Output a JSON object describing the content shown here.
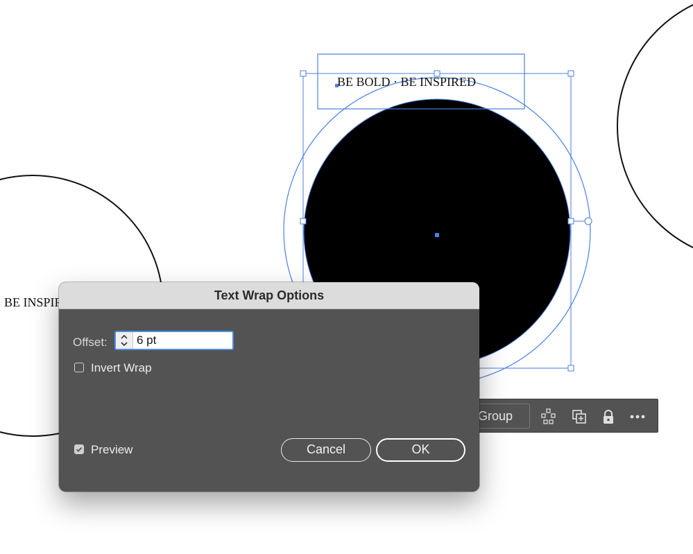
{
  "artboard": {
    "circle_text": "BE BOLD · BE INSPIRED",
    "left_text": "BE INSPIRED",
    "fill_color": "#000000",
    "selection_color": "#4a7fe0"
  },
  "taskbar": {
    "group_label": "Group",
    "icons": [
      "isolate-group-icon",
      "duplicate-icon",
      "lock-icon",
      "more-options-icon"
    ]
  },
  "dialog": {
    "title": "Text Wrap Options",
    "offset_label": "Offset:",
    "offset_value": "6 pt",
    "invert_wrap_label": "Invert Wrap",
    "invert_wrap_checked": false,
    "preview_label": "Preview",
    "preview_checked": true,
    "cancel_label": "Cancel",
    "ok_label": "OK"
  }
}
